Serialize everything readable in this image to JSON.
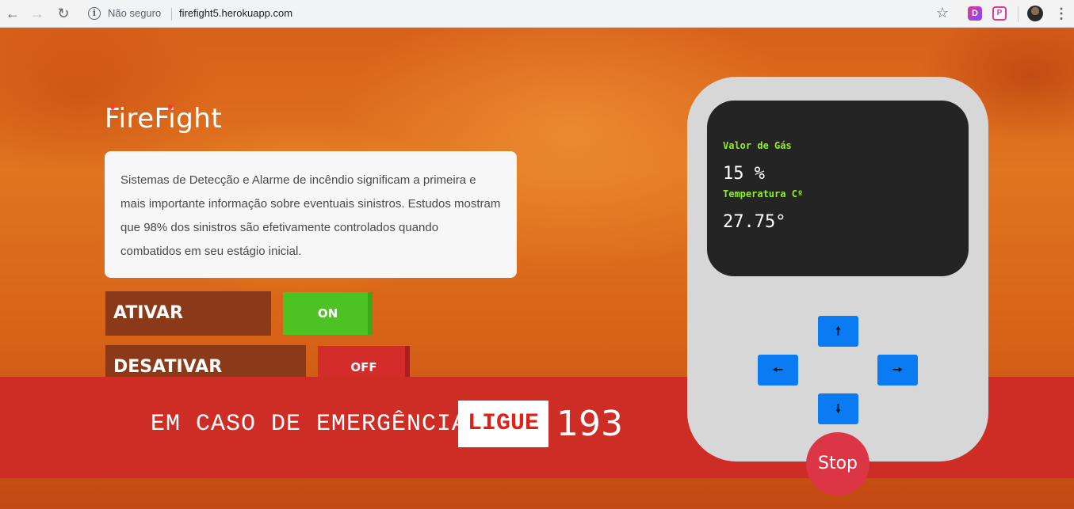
{
  "browser": {
    "security_label": "Não seguro",
    "url": "firefight5.herokuapp.com",
    "extensions": [
      "D",
      "P"
    ]
  },
  "hero": {
    "logo": "FireFight",
    "description": "Sistemas de Detecção e Alarme de incêndio significam a primeira e mais importante informação sobre eventuais sinistros. Estudos mostram que 98% dos sinistros são efetivamente controlados quando combatidos em seu estágio inicial."
  },
  "controls": {
    "activate_label": "ATIVAR ALARME",
    "on_label": "ON",
    "deactivate_label": "DESATIVAR ALARME",
    "off_label": "OFF"
  },
  "banner": {
    "text": "EM CASO DE EMERGÊNCIA",
    "call": "LIGUE",
    "number": "193"
  },
  "device": {
    "gas_label": "Valor de Gás",
    "gas_value": "15 %",
    "temp_label": "Temperatura Cº",
    "temp_value": "27.75°",
    "stop_label": "Stop"
  },
  "colors": {
    "on": "#4cc322",
    "off": "#d42b2b",
    "banner": "#ce2d26",
    "dpad": "#0a7bf2",
    "stop": "#dc3545",
    "screen_label": "#8ff022"
  }
}
